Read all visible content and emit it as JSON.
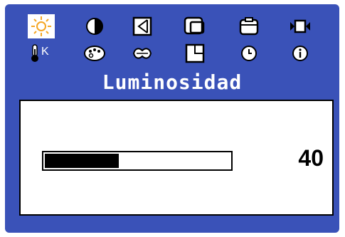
{
  "osd": {
    "title": "Luminosidad",
    "brightness_value": "40",
    "brightness_fraction": 0.4,
    "icons_row1": [
      "brightness-icon",
      "contrast-icon",
      "geometry-icon",
      "position-icon",
      "size-icon",
      "video-icon"
    ],
    "icons_row2": [
      "color-temperature-icon",
      "color-palette-icon",
      "language-icon",
      "window-icon",
      "clock-icon",
      "information-icon"
    ],
    "selected_icon": "brightness-icon",
    "color_temp_label": "K",
    "colors": {
      "background": "#3a52b8",
      "icon_fill": "#ffffff",
      "selected_bg": "#ffffff",
      "accent": "#f5a623"
    }
  }
}
